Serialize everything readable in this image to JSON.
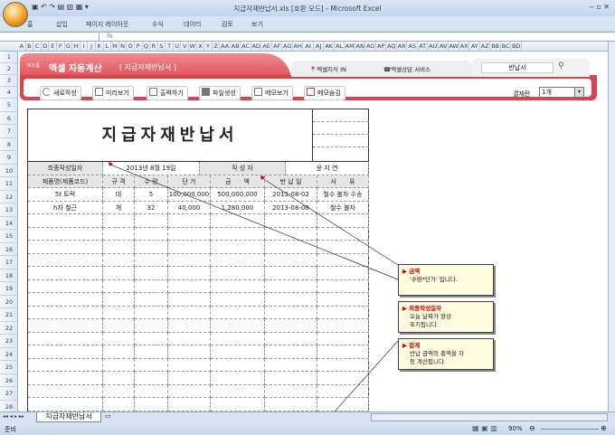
{
  "window": {
    "title": "지급자재반납서.xls  [호환 모드]  -  Microsoft Excel"
  },
  "ribbon_tabs": [
    "홈",
    "삽입",
    "페이지 레이아웃",
    "수식",
    "데이터",
    "검토",
    "보기"
  ],
  "formula_bar": {
    "fx": "fx",
    "value": ""
  },
  "columns": [
    "A",
    "B",
    "C",
    "D",
    "E",
    "F",
    "G",
    "H",
    "I",
    "J",
    "K",
    "L",
    "M",
    "N",
    "O",
    "P",
    "Q",
    "R",
    "S",
    "T",
    "U",
    "V",
    "W",
    "X",
    "Y",
    "Z",
    "AA",
    "AB",
    "AC",
    "AD",
    "AE",
    "AF",
    "AG",
    "AH",
    "AI",
    "AJ",
    "AK",
    "AL",
    "AM",
    "AN",
    "AO",
    "AP",
    "AQ",
    "AR",
    "AS",
    "AT",
    "AU",
    "AV",
    "AW",
    "AX",
    "AY",
    "AZ",
    "BB",
    "BC",
    "BD"
  ],
  "rows": [
    "1",
    "2",
    "3",
    "4",
    "5",
    "6",
    "7",
    "8",
    "9",
    "10",
    "11",
    "12",
    "13",
    "14",
    "15",
    "16",
    "17",
    "18",
    "19",
    "20",
    "21",
    "22",
    "23",
    "24",
    "25",
    "26",
    "27",
    "28"
  ],
  "banner": {
    "brand_small": "비즈폼",
    "brand": "엑셀 자동계산",
    "subtitle": "[ 지급자재반납서 ]",
    "link1": "엑셀지식 IN",
    "link2": "엑셀상담 서비스",
    "search_value": "반납서",
    "buttons": [
      "새로작성",
      "미리보기",
      "출력하기",
      "파일생성",
      "메모보기",
      "메모숨김"
    ],
    "payment_label": "결재란",
    "payment_value": "1개"
  },
  "document": {
    "title": "지급자재반납서",
    "date_label": "최종작성일자",
    "date_value": "2013년 8월 19일",
    "author_label": "작 성 자",
    "author_value": "윤 지 연",
    "headers": [
      "제품명(제품코드)",
      "규 격",
      "수 량",
      "단 가",
      "금　　액",
      "반 납 일",
      "사　　유"
    ],
    "items": [
      [
        "5t 트럭",
        "대",
        "5",
        "100,000,000",
        "500,000,000",
        "2013-08-02",
        "철수 불자 수송"
      ],
      [
        "h자 철근",
        "개",
        "32",
        "40,000",
        "1,280,000",
        "2013-08-08",
        "철수 불자"
      ]
    ]
  },
  "comments": [
    {
      "title": "금액",
      "text": "'수량*단가' 입니다."
    },
    {
      "title": "최종작성일자",
      "text": "오늘 날짜가 항상 표기됩니다."
    },
    {
      "title": "합계",
      "text": "반납 금액의 총액을 자동 계산됩니다."
    }
  ],
  "sheet_tab": "지급자재반납서",
  "status": {
    "text": "준비",
    "zoom": "90%"
  }
}
